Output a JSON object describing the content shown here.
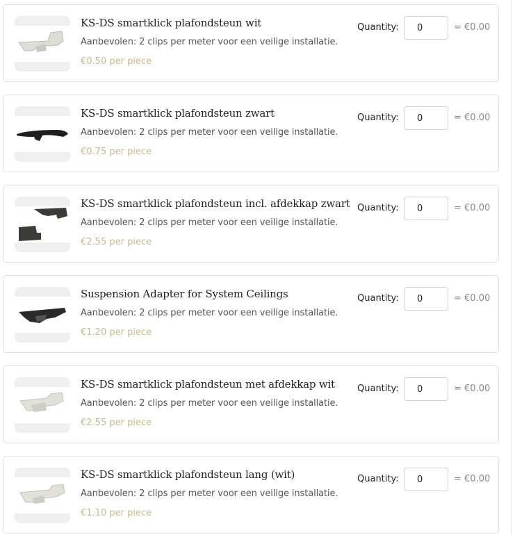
{
  "quantity_label": "Quantity:",
  "products": [
    {
      "title": "KS-DS smartklick plafondsteun wit",
      "description": "Aanbevolen: 2 clips per meter voor een veilige installatie.",
      "price": "€0.50 per piece",
      "quantity": "0",
      "line_total": "= €0.00",
      "image_icon": "white-ceiling-clip-icon"
    },
    {
      "title": "KS-DS smartklick plafondsteun zwart",
      "description": "Aanbevolen: 2 clips per meter voor een veilige installatie.",
      "price": "€0.75 per piece",
      "quantity": "0",
      "line_total": "= €0.00",
      "image_icon": "black-ceiling-clip-icon"
    },
    {
      "title": "KS-DS smartklick plafondsteun incl. afdekkap zwart",
      "description": "Aanbevolen: 2 clips per meter voor een veilige installatie.",
      "price": "€2.55 per piece",
      "quantity": "0",
      "line_total": "= €0.00",
      "image_icon": "black-clip-with-cover-icon"
    },
    {
      "title": "Suspension Adapter for System Ceilings",
      "description": "Aanbevolen: 2 clips per meter voor een veilige installatie.",
      "price": "€1.20 per piece",
      "quantity": "0",
      "line_total": "= €0.00",
      "image_icon": "suspension-adapter-icon"
    },
    {
      "title": "KS-DS smartklick plafondsteun met afdekkap wit",
      "description": "Aanbevolen: 2 clips per meter voor een veilige installatie.",
      "price": "€2.55 per piece",
      "quantity": "0",
      "line_total": "= €0.00",
      "image_icon": "white-clip-with-cover-icon"
    },
    {
      "title": "KS-DS smartklick plafondsteun lang (wit)",
      "description": "Aanbevolen: 2 clips per meter voor een veilige installatie.",
      "price": "€1.10 per piece",
      "quantity": "0",
      "line_total": "= €0.00",
      "image_icon": "long-white-clip-icon"
    }
  ]
}
